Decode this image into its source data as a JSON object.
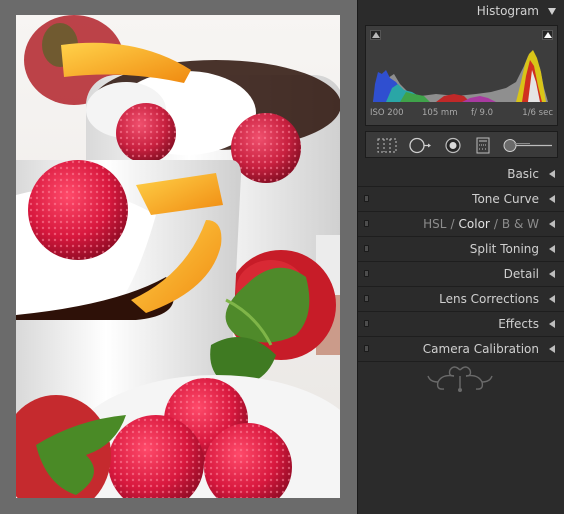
{
  "histogram": {
    "title": "Histogram",
    "iso": "ISO 200",
    "focal_length": "105 mm",
    "aperture": "f/ 9.0",
    "shutter": "1/6 sec"
  },
  "tools": [
    "crop-overlay-icon",
    "spot-removal-icon",
    "red-eye-icon",
    "graduated-filter-icon",
    "adjustment-brush-icon"
  ],
  "sections": {
    "basic": "Basic",
    "tone_curve": "Tone Curve",
    "hsl": "HSL",
    "color": "Color",
    "bw": "B & W",
    "hsl_separator": "/",
    "split_toning": "Split Toning",
    "detail": "Detail",
    "lens_corrections": "Lens Corrections",
    "effects": "Effects",
    "camera_calibration": "Camera Calibration"
  },
  "colors": {
    "panel_bg": "#2b2b2b",
    "canvas_bg": "#6b6b6b",
    "label_text": "#d0d0d0"
  }
}
